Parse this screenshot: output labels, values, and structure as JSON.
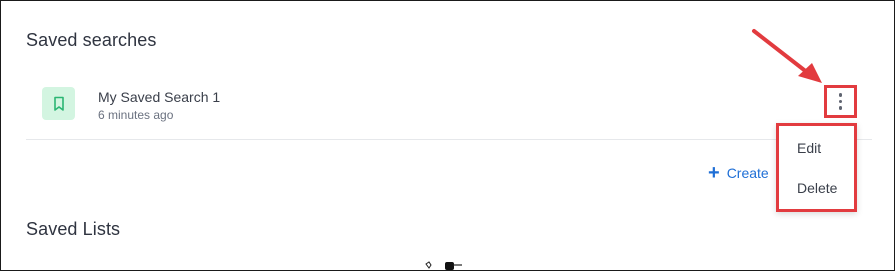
{
  "saved_searches": {
    "title": "Saved searches",
    "items": [
      {
        "name": "My Saved Search 1",
        "time": "6 minutes ago",
        "icon": "bookmark-icon"
      }
    ],
    "create_label": "Create",
    "menu": {
      "items": [
        "Edit",
        "Delete"
      ]
    }
  },
  "saved_lists": {
    "title": "Saved Lists"
  },
  "colors": {
    "highlight": "#e23b3f",
    "link": "#1f6fd6",
    "bookmark_bg": "#d3f5e1",
    "bookmark_icon": "#2bb673"
  }
}
